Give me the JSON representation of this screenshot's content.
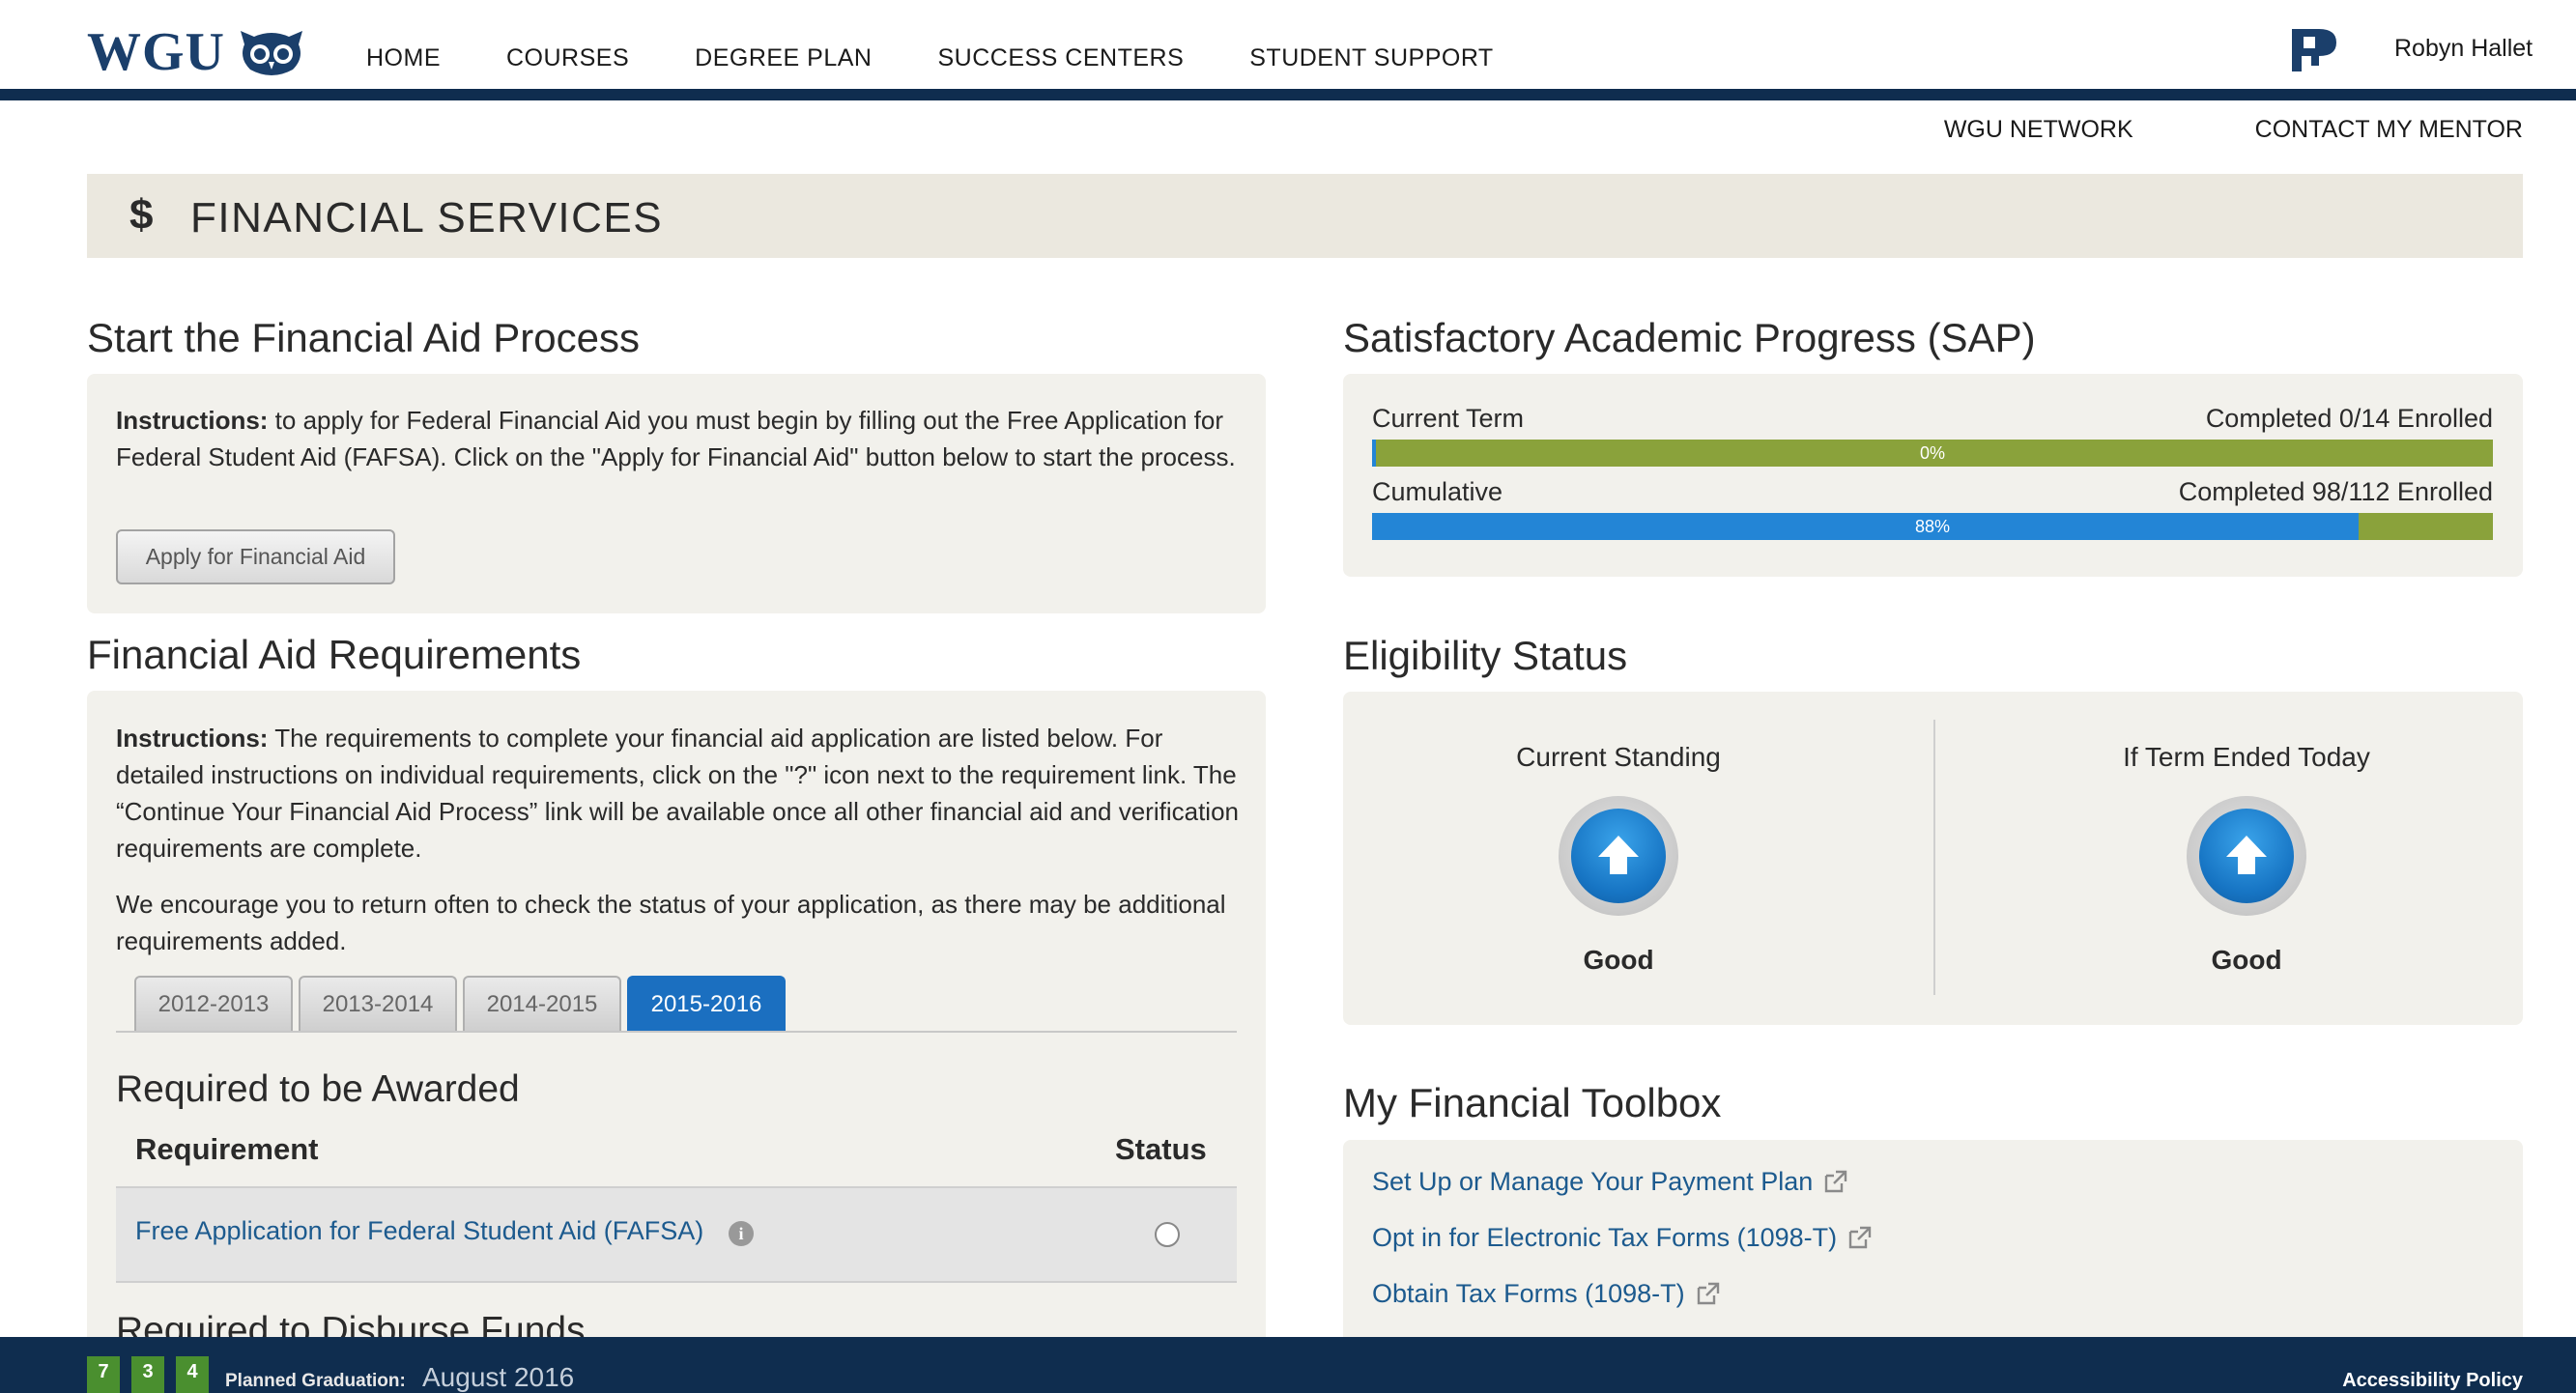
{
  "header": {
    "logo_text": "WGU",
    "nav": [
      "HOME",
      "COURSES",
      "DEGREE PLAN",
      "SUCCESS CENTERS",
      "STUDENT SUPPORT"
    ],
    "user_name": "Robyn Hallet",
    "sub_links": [
      "WGU NETWORK",
      "CONTACT MY MENTOR"
    ]
  },
  "page": {
    "icon": "dollar-icon",
    "dollar_glyph": "$",
    "title": "FINANCIAL SERVICES"
  },
  "start_aid": {
    "heading": "Start the Financial Aid Process",
    "instr_bold": "Instructions:",
    "instr_text": " to apply for Federal Financial Aid you must begin by filling out the Free Application for Federal Student Aid (FAFSA). Click on the \"Apply for Financial Aid\" button below to start the process.",
    "button_label": "Apply for Financial Aid"
  },
  "requirements": {
    "heading": "Financial Aid Requirements",
    "instr_bold": "Instructions:",
    "instr_text": " The requirements to complete your financial aid application are listed below. For detailed instructions on individual requirements, click on the \"?\" icon next to the requirement link. The “Continue Your Financial Aid Process” link will be available once all other financial aid and verification requirements are complete.",
    "encourage_text": "We encourage you to return often to check the status of your application, as there may be additional requirements added.",
    "tabs": [
      "2012-2013",
      "2013-2014",
      "2014-2015",
      "2015-2016"
    ],
    "active_tab": "2015-2016",
    "awarded_heading": "Required to be Awarded",
    "col_requirement": "Requirement",
    "col_status": "Status",
    "rows": [
      {
        "label": "Free Application for Federal Student Aid (FAFSA)",
        "status": "incomplete"
      }
    ],
    "disburse_heading": "Required to Disburse Funds"
  },
  "sap": {
    "heading": "Satisfactory Academic Progress (SAP)",
    "current_term": {
      "label": "Current Term",
      "status": "Completed 0/14 Enrolled",
      "percent_text": "0%",
      "percent": 0
    },
    "cumulative": {
      "label": "Cumulative",
      "status": "Completed 98/112 Enrolled",
      "percent_text": "88%",
      "percent": 88
    }
  },
  "eligibility": {
    "heading": "Eligibility Status",
    "items": [
      {
        "label": "Current Standing",
        "status": "Good"
      },
      {
        "label": "If Term Ended Today",
        "status": "Good"
      }
    ]
  },
  "toolbox": {
    "heading": "My Financial Toolbox",
    "links": [
      "Set Up or Manage Your Payment Plan",
      "Opt in for Electronic Tax Forms (1098-T)",
      "Obtain Tax Forms (1098-T)"
    ]
  },
  "footer": {
    "badges": [
      "7",
      "3",
      "4"
    ],
    "graduation_label": "Planned Graduation:",
    "graduation_value": "August 2016",
    "accessibility": "Accessibility Policy"
  },
  "colors": {
    "navy": "#0f2d4f",
    "accent_blue": "#1b6fc0",
    "progress_green": "#8aa23b",
    "link_blue": "#1c5a8e"
  }
}
